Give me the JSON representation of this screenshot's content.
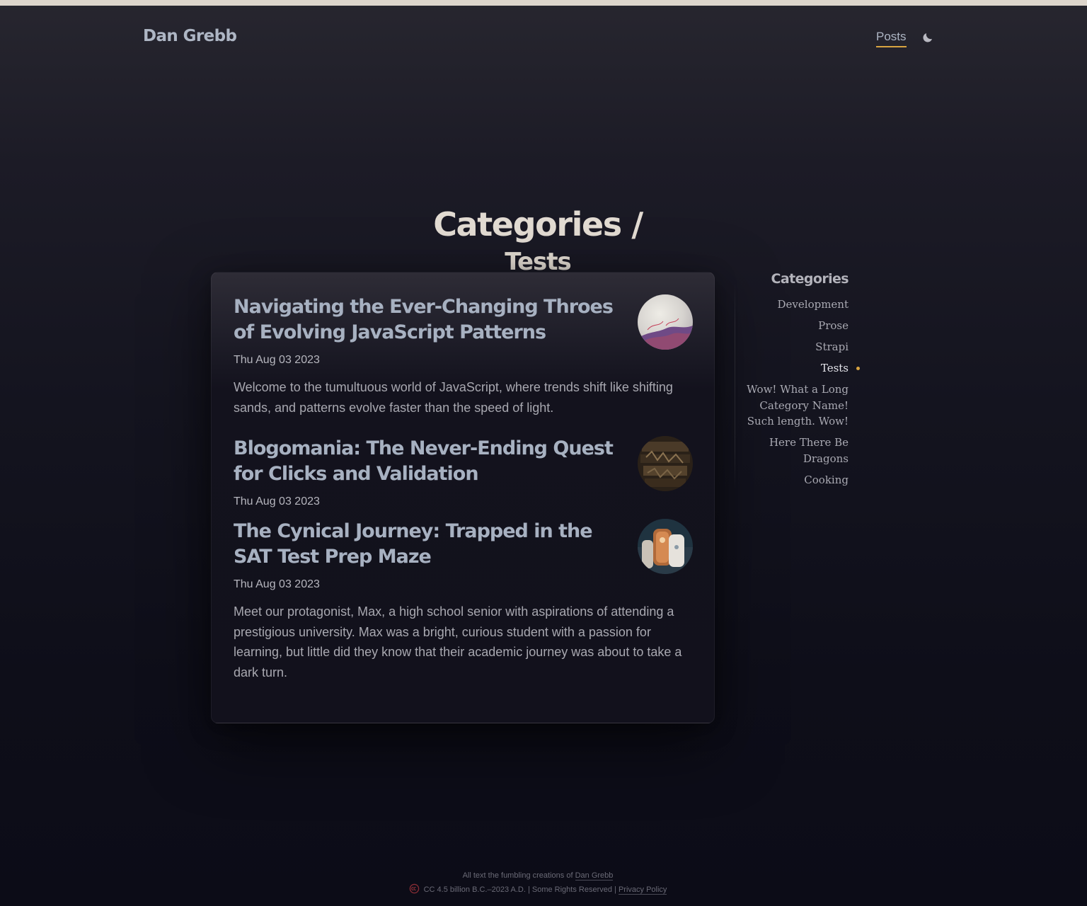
{
  "header": {
    "site_title": "Dan Grebb",
    "nav_posts": "Posts",
    "theme_icon": "moon-icon"
  },
  "page": {
    "heading_line1": "Categories /",
    "heading_line2": "Tests"
  },
  "posts": [
    {
      "title": "Navigating the Ever-Changing Throes of Evolving JavaScript Patterns",
      "date": "Thu Aug 03 2023",
      "excerpt": "Welcome to the tumultuous world of JavaScript, where trends shift like shifting sands, and patterns evolve faster than the speed of light."
    },
    {
      "title": "Blogomania: The Never-Ending Quest for Clicks and Validation",
      "date": "Thu Aug 03 2023",
      "excerpt": ""
    },
    {
      "title": "The Cynical Journey: Trapped in the SAT Test Prep Maze",
      "date": "Thu Aug 03 2023",
      "excerpt": "Meet our protagonist, Max, a high school senior with aspirations of attending a prestigious university. Max was a bright, curious student with a passion for learning, but little did they know that their academic journey was about to take a dark turn."
    }
  ],
  "sidebar": {
    "heading": "Categories",
    "items": [
      {
        "label": "Development",
        "active": false
      },
      {
        "label": "Prose",
        "active": false
      },
      {
        "label": "Strapi",
        "active": false
      },
      {
        "label": "Tests",
        "active": true
      },
      {
        "label": "Wow! What a Long Category Name! Such length. Wow!",
        "active": false
      },
      {
        "label": "Here There Be Dragons",
        "active": false
      },
      {
        "label": "Cooking",
        "active": false
      }
    ]
  },
  "footer": {
    "line1_prefix": "All text the fumbling creations of",
    "line1_link": "Dan Grebb",
    "line2_text": "CC 4.5 billion B.C.–2023 A.D. | Some Rights Reserved |",
    "line2_link": "Privacy Policy"
  },
  "colors": {
    "accent": "#d9a441",
    "heading": "#e2dbd2",
    "post_title": "#a7b1c1"
  }
}
